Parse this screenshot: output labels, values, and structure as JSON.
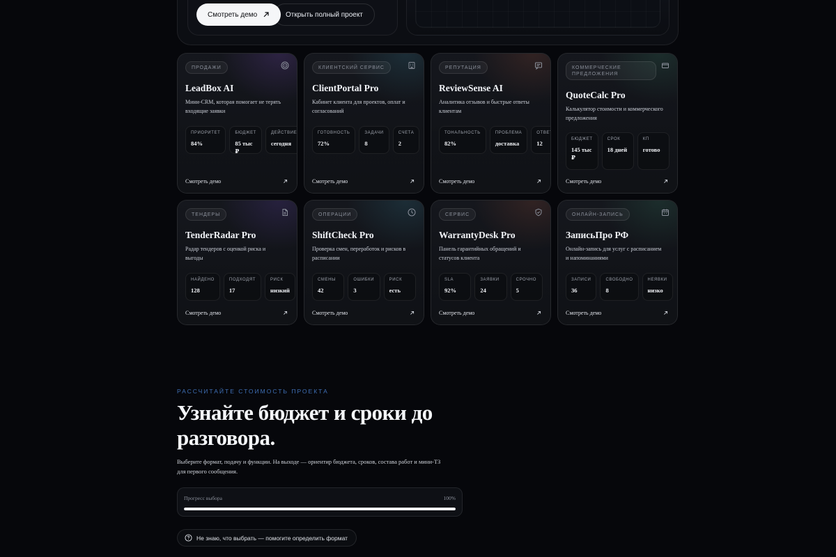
{
  "hero": {
    "demo_button": "Смотреть демо",
    "full_project_button": "Открыть полный проект"
  },
  "cards": [
    {
      "tag": "Продажи",
      "icon": "target-icon",
      "title": "LeadBox AI",
      "desc": "Мини-CRM, которая помогает не терять входящие заявки",
      "stats": [
        {
          "label": "Приоритет",
          "value": "84%"
        },
        {
          "label": "Бюджет",
          "value": "85 тыс ₽"
        },
        {
          "label": "Действие",
          "value": "сегодня"
        }
      ],
      "link": "Смотреть демо",
      "glow": "#5b3a8c"
    },
    {
      "tag": "Клиентский сервис",
      "icon": "building-icon",
      "title": "ClientPortal Pro",
      "desc": "Кабинет клиента для проектов, оплат и согласований",
      "stats": [
        {
          "label": "Готовность",
          "value": "72%"
        },
        {
          "label": "Задачи",
          "value": "8"
        },
        {
          "label": "Счета",
          "value": "2"
        }
      ],
      "link": "Смотреть демо",
      "glow": "#2a5a6a"
    },
    {
      "tag": "Репутация",
      "icon": "message-icon",
      "title": "ReviewSense AI",
      "desc": "Аналитика отзывов и быстрые ответы клиентам",
      "stats": [
        {
          "label": "Тональность",
          "value": "82%"
        },
        {
          "label": "Проблема",
          "value": "доставка"
        },
        {
          "label": "Ответы",
          "value": "12"
        }
      ],
      "link": "Смотреть демо",
      "glow": "#6a3a2e"
    },
    {
      "tag": "Коммерческие предложения",
      "icon": "card-icon",
      "title": "QuoteCalc Pro",
      "desc": "Калькулятор стоимости и коммерческого предложения",
      "stats": [
        {
          "label": "Бюджет",
          "value": "145 тыс ₽"
        },
        {
          "label": "Срок",
          "value": "18 дней"
        },
        {
          "label": "КП",
          "value": "готово"
        }
      ],
      "link": "Смотреть демо",
      "glow": "#2a5a4a"
    },
    {
      "tag": "Тендеры",
      "icon": "document-icon",
      "title": "TenderRadar Pro",
      "desc": "Радар тендеров с оценкой риска и выгоды",
      "stats": [
        {
          "label": "Найдено",
          "value": "128"
        },
        {
          "label": "Подходят",
          "value": "17"
        },
        {
          "label": "Риск",
          "value": "низкий"
        }
      ],
      "link": "Смотреть демо",
      "glow": "#4a3580"
    },
    {
      "tag": "Операции",
      "icon": "clock-icon",
      "title": "ShiftCheck Pro",
      "desc": "Проверка смен, переработок и рисков в расписании",
      "stats": [
        {
          "label": "Смены",
          "value": "42"
        },
        {
          "label": "Ошибки",
          "value": "3"
        },
        {
          "label": "Риск",
          "value": "есть"
        }
      ],
      "link": "Смотреть демо",
      "glow": "#2a5a6a"
    },
    {
      "tag": "Сервис",
      "icon": "shield-icon",
      "title": "WarrantyDesk Pro",
      "desc": "Панель гарантийных обращений и статусов клиента",
      "stats": [
        {
          "label": "SLA",
          "value": "92%"
        },
        {
          "label": "Заявки",
          "value": "24"
        },
        {
          "label": "Срочно",
          "value": "5"
        }
      ],
      "link": "Смотреть демо",
      "glow": "#6a3a2e"
    },
    {
      "tag": "Онлайн-запись",
      "icon": "calendar-icon",
      "title": "ЗаписьПро РФ",
      "desc": "Онлайн-запись для услуг с расписанием и напоминаниями",
      "stats": [
        {
          "label": "Записи",
          "value": "36"
        },
        {
          "label": "Свободно",
          "value": "8"
        },
        {
          "label": "Неявки",
          "value": "низко"
        }
      ],
      "link": "Смотреть демо",
      "glow": "#2a5a4a"
    }
  ],
  "calculator": {
    "eyebrow": "Рассчитайте стоимость проекта",
    "headline": "Узнайте бюджет и сроки до разговора.",
    "subtext": "Выберите формат, подачу и функции. На выходе — ориентир бюджета, сроков, состава работ и мини-ТЗ для первого сообщения.",
    "progress_label": "Прогресс выбора",
    "progress_value": "100%",
    "progress_fraction": 1.0,
    "help_button": "Не знаю, что выбрать — помогите определить формат"
  }
}
